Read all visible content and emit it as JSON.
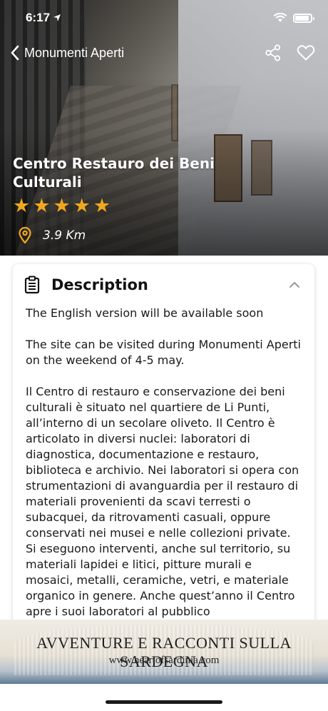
{
  "status_bar": {
    "time": "6:17"
  },
  "nav": {
    "back_label": "Monumenti Aperti"
  },
  "hero": {
    "title": "Centro Restauro dei Beni Culturali",
    "rating": 5,
    "rating_max": 5,
    "distance": "3.9 Km"
  },
  "description": {
    "title": "Description",
    "paragraphs": [
      "The English version will be available soon",
      "The site can be visited during Monumenti Aperti on the weekend of 4-5 may.",
      "Il Centro di restauro e conservazione dei beni culturali è situato nel quartiere de Li Punti, all’interno di un secolare oliveto. Il Centro è articolato in diversi nuclei: laboratori di diagnostica, documentazione e restauro, biblioteca e archivio. Nei laboratori si opera con strumentazioni di avanguardia per il restauro di materiali provenienti da scavi terresti o subacquei, da ritrovamenti casuali, oppure conservati nei musei e nelle collezioni private. Si eseguono interventi, anche sul territorio, su materiali lapidei e litici, pitture murali e mosaici, metalli, ceramiche, vetri, e materiale organico in genere. Anche quest’anno il Centro apre i suoi laboratori al pubblico"
    ]
  },
  "banner": {
    "title": "AVVENTURE E RACCONTI SULLA SARDEGNA",
    "url": "www.heartofsardinia.com"
  },
  "icons": {
    "back": "chevron-left-icon",
    "share": "share-icon",
    "favorite": "heart-icon",
    "location": "map-pin-icon",
    "description": "clipboard-icon",
    "collapse": "chevron-up-icon"
  },
  "colors": {
    "star": "#f2a81d",
    "location_pin": "#f2a81d"
  }
}
